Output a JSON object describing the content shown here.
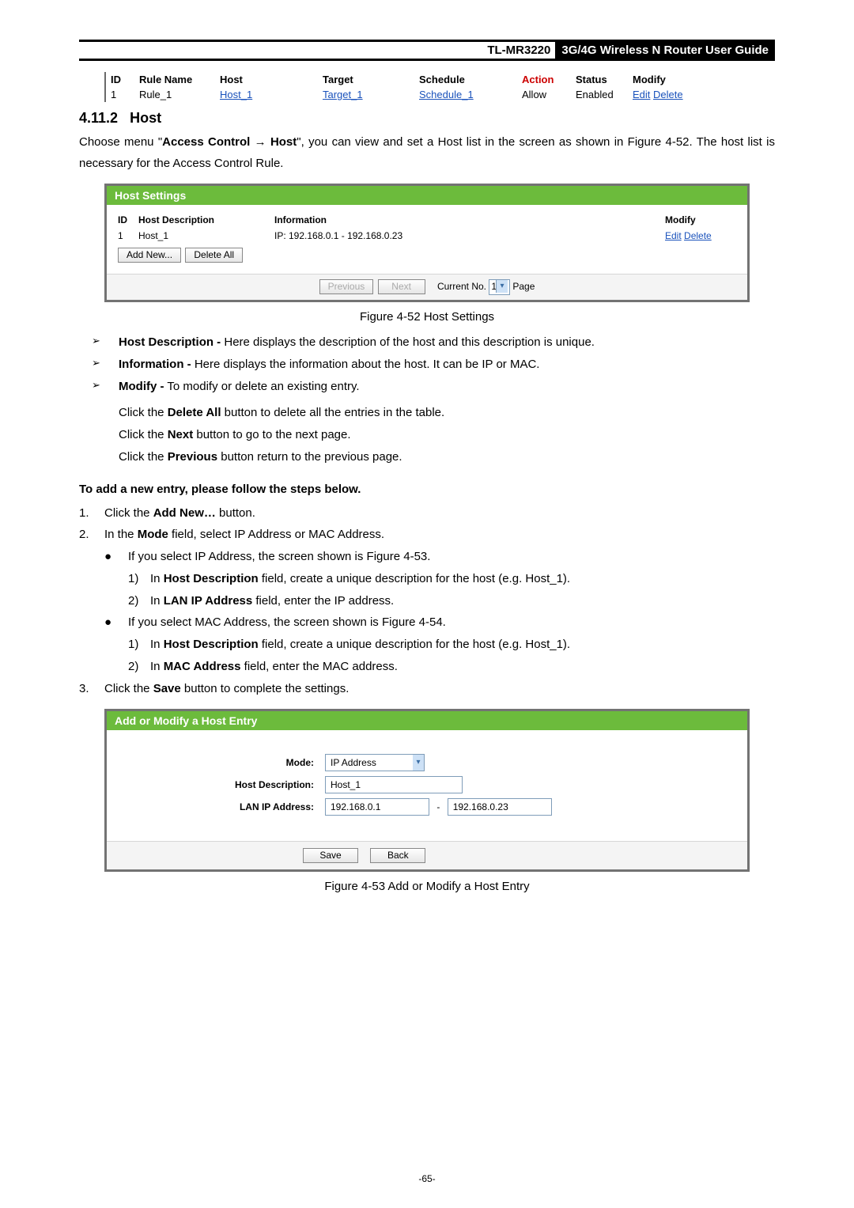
{
  "header": {
    "model": "TL-MR3220",
    "title": "3G/4G Wireless N Router User Guide"
  },
  "ruleTable": {
    "headers": {
      "id": "ID",
      "ruleName": "Rule Name",
      "host": "Host",
      "target": "Target",
      "schedule": "Schedule",
      "action": "Action",
      "status": "Status",
      "modify": "Modify"
    },
    "row": {
      "id": "1",
      "ruleName": "Rule_1",
      "host": "Host_1",
      "target": "Target_1",
      "schedule": "Schedule_1",
      "action": "Allow",
      "status": "Enabled",
      "edit": "Edit",
      "delete": "Delete"
    }
  },
  "section": {
    "number": "4.11.2",
    "title": "Host",
    "intro1a": "Choose menu \"",
    "intro1b": "Access Control",
    "intro1arrow": " → ",
    "intro1c": "Host",
    "intro1d": "\", you can view and set a Host list in the screen as shown in Figure 4-52. The host list is necessary for the Access Control Rule."
  },
  "hostFig": {
    "title": "Host Settings",
    "headers": {
      "id": "ID",
      "desc": "Host Description",
      "info": "Information",
      "modify": "Modify"
    },
    "row": {
      "id": "1",
      "desc": "Host_1",
      "info": "IP: 192.168.0.1 - 192.168.0.23",
      "edit": "Edit",
      "delete": "Delete"
    },
    "addNew": "Add New...",
    "deleteAll": "Delete All",
    "prev": "Previous",
    "next": "Next",
    "currentNoLabel": "Current No.",
    "currentNoVal": "1",
    "pageLabel": "Page",
    "caption": "Figure 4-52    Host Settings"
  },
  "bullets": {
    "b1a": "Host Description -",
    "b1b": " Here displays the description of the host and this description is unique.",
    "b2a": "Information -",
    "b2b": " Here displays the information about the host. It can be IP or MAC.",
    "b3a": "Modify -",
    "b3b": " To modify or delete an existing entry.",
    "s1a": "Click the ",
    "s1b": "Delete All",
    "s1c": " button to delete all the entries in the table.",
    "s2a": "Click the ",
    "s2b": "Next",
    "s2c": " button to go to the next page.",
    "s3a": "Click the ",
    "s3b": "Previous",
    "s3c": " button return to the previous page."
  },
  "steps": {
    "heading": "To add a new entry, please follow the steps below.",
    "n1a": "Click the ",
    "n1b": "Add New…",
    "n1c": " button.",
    "n2a": "In the ",
    "n2b": "Mode",
    "n2c": " field, select IP Address or MAC Address.",
    "d1": "If you select IP Address, the screen shown is Figure 4-53.",
    "d1s1a": "In ",
    "d1s1b": "Host Description",
    "d1s1c": " field, create a unique description for the host (e.g. Host_1).",
    "d1s2a": "In ",
    "d1s2b": "LAN IP Address",
    "d1s2c": " field, enter the IP address.",
    "d2": "If you select MAC Address, the screen shown is Figure 4-54.",
    "d2s1a": "In ",
    "d2s1b": "Host Description",
    "d2s1c": " field, create a unique description for the host (e.g. Host_1).",
    "d2s2a": "In ",
    "d2s2b": "MAC Address",
    "d2s2c": " field, enter the MAC address.",
    "n3a": "Click the ",
    "n3b": "Save",
    "n3c": " button to complete the settings."
  },
  "addFig": {
    "title": "Add or Modify a Host Entry",
    "modeLabel": "Mode:",
    "modeVal": "IP Address",
    "descLabel": "Host Description:",
    "descVal": "Host_1",
    "ipLabel": "LAN IP Address:",
    "ipFrom": "192.168.0.1",
    "dash": "-",
    "ipTo": "192.168.0.23",
    "save": "Save",
    "back": "Back",
    "caption": "Figure 4-53    Add or Modify a Host Entry"
  },
  "pageNo": "-65-"
}
